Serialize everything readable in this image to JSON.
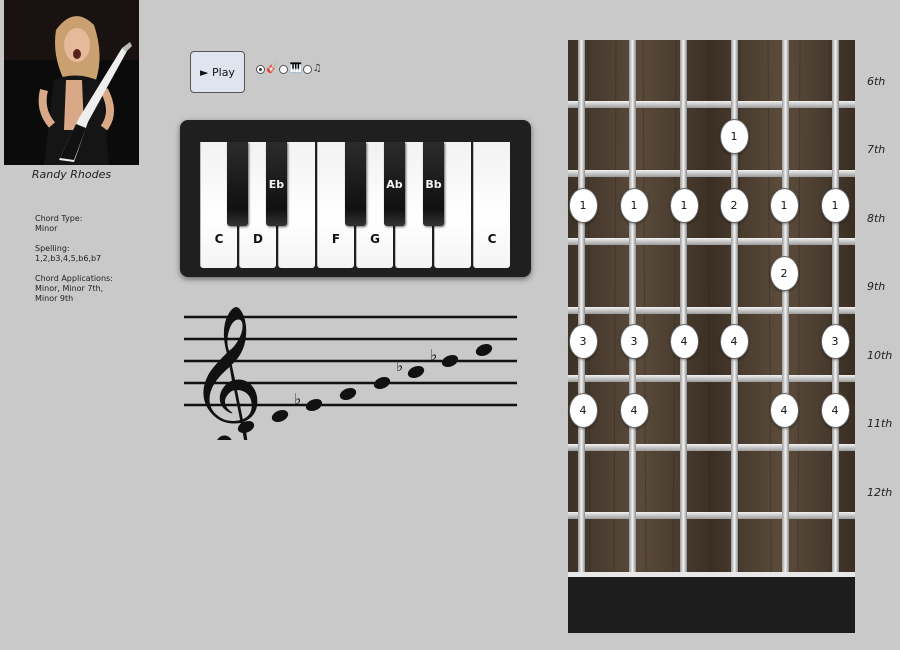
{
  "artist": {
    "caption": "Randy Rhodes"
  },
  "info": {
    "chord_type_label": "Chord Type:",
    "chord_type": "Minor",
    "spelling_label": "Spelling:",
    "spelling": "1,2,b3,4,5,b6,b7",
    "applications_label": "Chord Applications:",
    "applications_line1": "Minor, Minor 7th,",
    "applications_line2": "Minor 9th"
  },
  "controls": {
    "play_label": "► Play",
    "modes": [
      {
        "icon": "guitar-icon",
        "glyph": "🎸",
        "selected": true
      },
      {
        "icon": "piano-icon",
        "glyph": "🎹",
        "selected": false
      },
      {
        "icon": "notes-icon",
        "glyph": "♫",
        "selected": false
      }
    ]
  },
  "piano": {
    "white_keys": [
      "C",
      "D",
      "",
      "F",
      "G",
      "",
      "",
      "C"
    ],
    "black_keys": [
      "",
      "Eb",
      "",
      "Ab",
      "Bb"
    ]
  },
  "staff": {
    "clef": "treble",
    "notes": [
      "C",
      "D",
      "Eb",
      "F",
      "G",
      "Ab",
      "Bb",
      "C"
    ]
  },
  "fretboard": {
    "fret_labels": [
      "6th",
      "7th",
      "8th",
      "9th",
      "10th",
      "11th",
      "12th"
    ],
    "markers": [
      {
        "string": 4,
        "fret": 7,
        "finger": "1"
      },
      {
        "string": 1,
        "fret": 8,
        "finger": "1"
      },
      {
        "string": 2,
        "fret": 8,
        "finger": "1"
      },
      {
        "string": 3,
        "fret": 8,
        "finger": "1"
      },
      {
        "string": 4,
        "fret": 8,
        "finger": "2"
      },
      {
        "string": 5,
        "fret": 8,
        "finger": "1"
      },
      {
        "string": 6,
        "fret": 8,
        "finger": "1"
      },
      {
        "string": 5,
        "fret": 9,
        "finger": "2"
      },
      {
        "string": 1,
        "fret": 10,
        "finger": "3"
      },
      {
        "string": 2,
        "fret": 10,
        "finger": "3"
      },
      {
        "string": 3,
        "fret": 10,
        "finger": "4"
      },
      {
        "string": 4,
        "fret": 10,
        "finger": "4"
      },
      {
        "string": 6,
        "fret": 10,
        "finger": "3"
      },
      {
        "string": 1,
        "fret": 11,
        "finger": "4"
      },
      {
        "string": 2,
        "fret": 11,
        "finger": "4"
      },
      {
        "string": 5,
        "fret": 11,
        "finger": "4"
      },
      {
        "string": 6,
        "fret": 11,
        "finger": "4"
      }
    ]
  },
  "colors": {
    "background": "#c9c9c9",
    "fretboard_wood": "#4a3c2e",
    "fret_metal": "#d8d8d8"
  }
}
